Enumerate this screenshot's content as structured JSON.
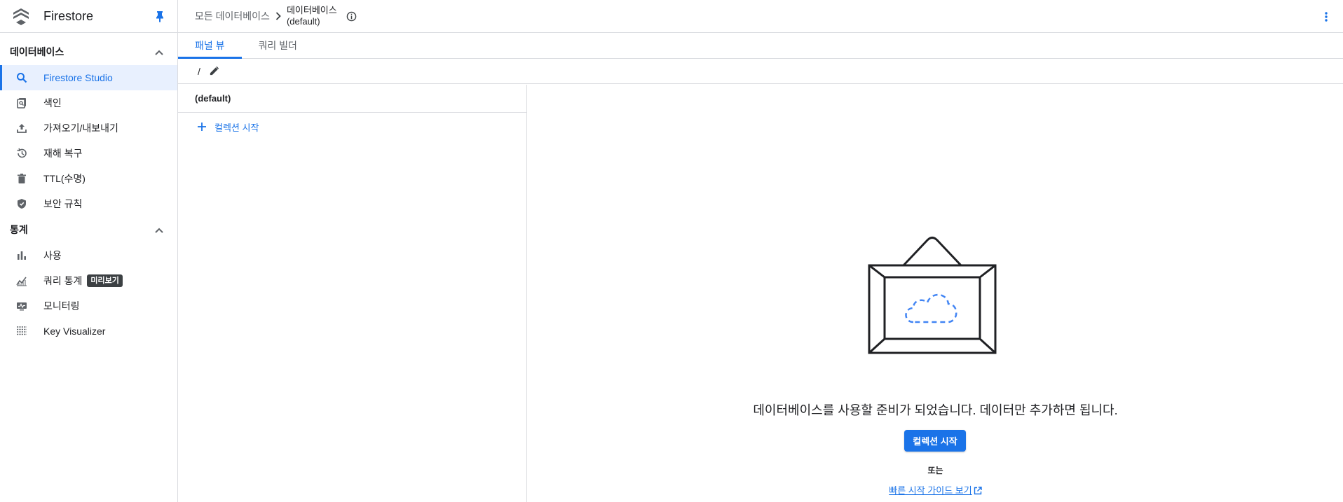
{
  "app": {
    "title": "Firestore"
  },
  "sidebar": {
    "sections": [
      {
        "label": "데이터베이스",
        "items": [
          {
            "label": "Firestore Studio",
            "icon": "search-icon",
            "active": true
          },
          {
            "label": "색인",
            "icon": "index-icon"
          },
          {
            "label": "가져오기/내보내기",
            "icon": "upload-icon"
          },
          {
            "label": "재해 복구",
            "icon": "history-icon"
          },
          {
            "label": "TTL(수명)",
            "icon": "trash-icon"
          },
          {
            "label": "보안 규칙",
            "icon": "shield-icon"
          }
        ]
      },
      {
        "label": "통계",
        "items": [
          {
            "label": "사용",
            "icon": "bar-chart-icon"
          },
          {
            "label": "쿼리 통계",
            "icon": "line-chart-icon",
            "badge": "미리보기"
          },
          {
            "label": "모니터링",
            "icon": "monitor-icon"
          },
          {
            "label": "Key Visualizer",
            "icon": "grid-icon"
          }
        ]
      }
    ]
  },
  "breadcrumb": {
    "root": "모든 데이터베이스",
    "current_line1": "데이터베이스",
    "current_line2": "(default)"
  },
  "tabs": [
    {
      "label": "패널 뷰",
      "active": true
    },
    {
      "label": "쿼리 빌더",
      "active": false
    }
  ],
  "path": {
    "text": "/"
  },
  "left_panel": {
    "header": "(default)",
    "start_collection": "컬렉션 시작"
  },
  "empty_state": {
    "message": "데이터베이스를 사용할 준비가 되었습니다. 데이터만 추가하면 됩니다.",
    "button": "컬렉션 시작",
    "or": "또는",
    "guide_link": "빠른 시작 가이드 보기"
  },
  "colors": {
    "accent": "#1a73e8",
    "active_bg": "#e8f0fe",
    "badge_bg": "#3c4043",
    "border": "#dadce0"
  }
}
